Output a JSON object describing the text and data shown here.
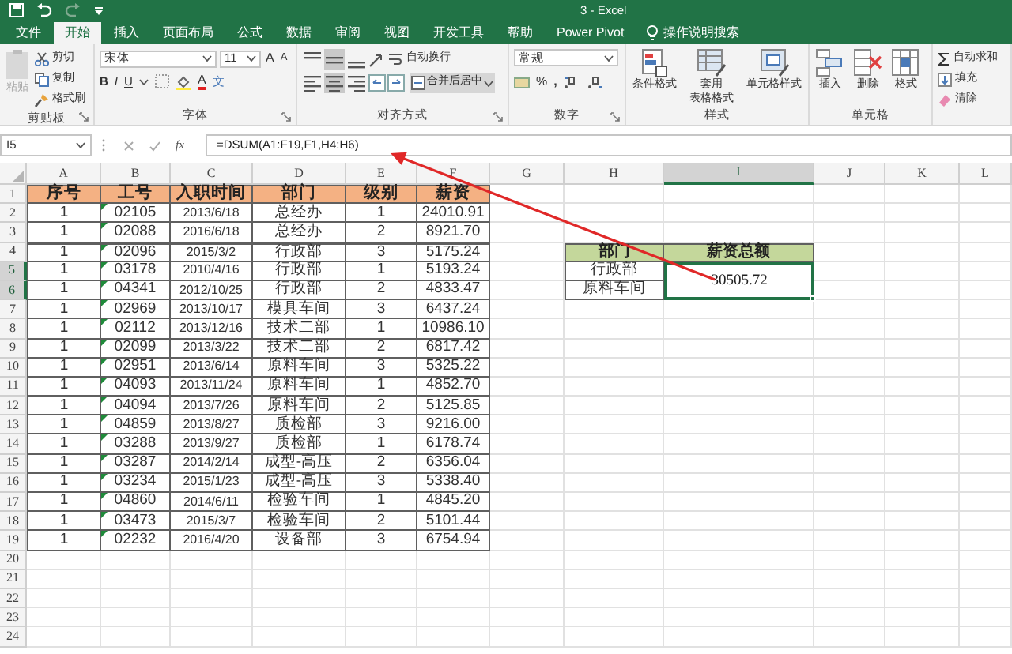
{
  "window": {
    "title": "3 - Excel"
  },
  "tabs": [
    {
      "label": "文件",
      "selected": false
    },
    {
      "label": "开始",
      "selected": true
    },
    {
      "label": "插入",
      "selected": false
    },
    {
      "label": "页面布局",
      "selected": false
    },
    {
      "label": "公式",
      "selected": false
    },
    {
      "label": "数据",
      "selected": false
    },
    {
      "label": "审阅",
      "selected": false
    },
    {
      "label": "视图",
      "selected": false
    },
    {
      "label": "开发工具",
      "selected": false
    },
    {
      "label": "帮助",
      "selected": false
    },
    {
      "label": "Power Pivot",
      "selected": false
    }
  ],
  "tell_me": "操作说明搜索",
  "ribbon": [
    {
      "kind": "clipboard",
      "label": "剪贴板",
      "paste": {
        "label": "粘贴",
        "disabled": true
      },
      "items": [
        "剪切",
        "复制",
        "格式刷"
      ]
    },
    {
      "kind": "font",
      "label": "字体",
      "font": "宋体",
      "size": "11",
      "size_buttons": [
        "A",
        "A"
      ],
      "styles": [
        "B",
        "I",
        "U"
      ],
      "color_button": "A",
      "phonetic_button": "文"
    },
    {
      "kind": "alignment",
      "label": "对齐方式",
      "wrap": "自动换行",
      "merge": "合并后居中"
    },
    {
      "kind": "number",
      "label": "数字",
      "format": "常规",
      "percent": "%",
      "comma": ","
    },
    {
      "kind": "styles",
      "label": "样式",
      "items": [
        [
          "条件格式"
        ],
        [
          "套用",
          "表格格式"
        ],
        [
          "单元格样式"
        ]
      ]
    },
    {
      "kind": "cells",
      "label": "单元格",
      "items": [
        "插入",
        "删除",
        "格式"
      ]
    },
    {
      "kind": "editing",
      "items": [
        "自动求和",
        "填充",
        "清除"
      ]
    }
  ],
  "formula_bar": {
    "name_box": "I5",
    "insert_function": "fx",
    "formula": "=DSUM(A1:F19,F1,H4:H6)"
  },
  "sheet": {
    "columns": [
      {
        "label": "A",
        "selected": false
      },
      {
        "label": "B",
        "selected": false
      },
      {
        "label": "C",
        "selected": false
      },
      {
        "label": "D",
        "selected": false
      },
      {
        "label": "E",
        "selected": false
      },
      {
        "label": "F",
        "selected": false
      },
      {
        "label": "G",
        "selected": false
      },
      {
        "label": "H",
        "selected": false
      },
      {
        "label": "I",
        "selected": true
      },
      {
        "label": "J",
        "selected": false
      },
      {
        "label": "K",
        "selected": false
      },
      {
        "label": "L",
        "selected": false
      }
    ],
    "rows": [
      {
        "label": "1",
        "selected": false
      },
      {
        "label": "2",
        "selected": false
      },
      {
        "label": "3",
        "selected": false
      },
      {
        "label": "4",
        "selected": false
      },
      {
        "label": "5",
        "selected": true
      },
      {
        "label": "6",
        "selected": true
      },
      {
        "label": "7",
        "selected": false
      },
      {
        "label": "8",
        "selected": false
      },
      {
        "label": "9",
        "selected": false
      },
      {
        "label": "10",
        "selected": false
      },
      {
        "label": "11",
        "selected": false
      },
      {
        "label": "12",
        "selected": false
      },
      {
        "label": "13",
        "selected": false
      },
      {
        "label": "14",
        "selected": false
      },
      {
        "label": "15",
        "selected": false
      },
      {
        "label": "16",
        "selected": false
      },
      {
        "label": "17",
        "selected": false
      },
      {
        "label": "18",
        "selected": false
      },
      {
        "label": "19",
        "selected": false
      },
      {
        "label": "20",
        "selected": false
      },
      {
        "label": "21",
        "selected": false
      },
      {
        "label": "22",
        "selected": false
      },
      {
        "label": "23",
        "selected": false
      },
      {
        "label": "24",
        "selected": false
      }
    ],
    "main_table": {
      "columns": [
        {
          "label": "序号",
          "flagged": false
        },
        {
          "label": "工号",
          "flagged": true
        },
        {
          "label": "入职时间",
          "flagged": false
        },
        {
          "label": "部门",
          "flagged": false
        },
        {
          "label": "级别",
          "flagged": false
        },
        {
          "label": "薪资",
          "flagged": false
        }
      ],
      "rows": [
        [
          "1",
          "02105",
          "2013/6/18",
          "总经办",
          "1",
          "24010.91"
        ],
        [
          "1",
          "02088",
          "2016/6/18",
          "总经办",
          "2",
          "8921.70"
        ],
        [
          "1",
          "02096",
          "2015/3/2",
          "行政部",
          "3",
          "5175.24"
        ],
        [
          "1",
          "03178",
          "2010/4/16",
          "行政部",
          "1",
          "5193.24"
        ],
        [
          "1",
          "04341",
          "2012/10/25",
          "行政部",
          "2",
          "4833.47"
        ],
        [
          "1",
          "02969",
          "2013/10/17",
          "模具车间",
          "3",
          "6437.24"
        ],
        [
          "1",
          "02112",
          "2013/12/16",
          "技术二部",
          "1",
          "10986.10"
        ],
        [
          "1",
          "02099",
          "2013/3/22",
          "技术二部",
          "2",
          "6817.42"
        ],
        [
          "1",
          "02951",
          "2013/6/14",
          "原料车间",
          "3",
          "5325.22"
        ],
        [
          "1",
          "04093",
          "2013/11/24",
          "原料车间",
          "1",
          "4852.70"
        ],
        [
          "1",
          "04094",
          "2013/7/26",
          "原料车间",
          "2",
          "5125.85"
        ],
        [
          "1",
          "04859",
          "2013/8/27",
          "质检部",
          "3",
          "9216.00"
        ],
        [
          "1",
          "03288",
          "2013/9/27",
          "质检部",
          "1",
          "6178.74"
        ],
        [
          "1",
          "03287",
          "2014/2/14",
          "成型-高压",
          "2",
          "6356.04"
        ],
        [
          "1",
          "03234",
          "2015/1/23",
          "成型-高压",
          "3",
          "5338.40"
        ],
        [
          "1",
          "04860",
          "2014/6/11",
          "检验车间",
          "1",
          "4845.20"
        ],
        [
          "1",
          "03473",
          "2015/3/7",
          "检验车间",
          "2",
          "5101.44"
        ],
        [
          "1",
          "02232",
          "2016/4/20",
          "设备部",
          "3",
          "6754.94"
        ]
      ]
    },
    "criteria_table": {
      "columns": [
        "部门",
        "薪资总额"
      ],
      "rows": [
        "行政部",
        "原料车间"
      ],
      "result": {
        "text": "30505.72",
        "selected": true
      }
    }
  }
}
